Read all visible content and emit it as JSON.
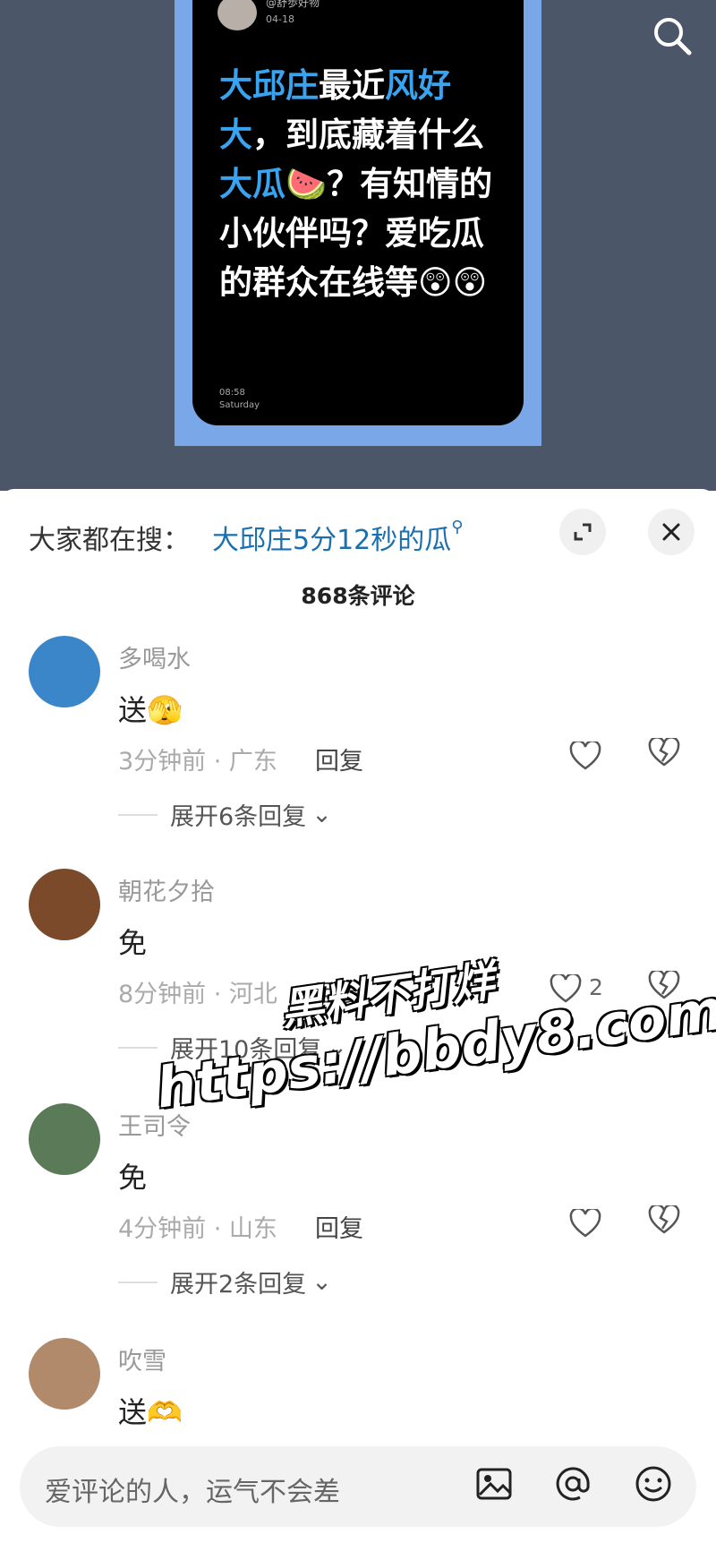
{
  "post": {
    "username": "@舒歩好物",
    "date": "04-18",
    "text_parts": [
      {
        "t": "大邱庄",
        "hl": true
      },
      {
        "t": "最近",
        "hl": false
      },
      {
        "t": "风好大",
        "hl": true
      },
      {
        "t": "，到底藏着什么",
        "hl": false
      },
      {
        "t": "大瓜",
        "hl": true
      },
      {
        "t": "🍉？有知情的小伙伴吗？爱吃瓜的群众在线等😲😲",
        "hl": false
      }
    ],
    "time": "08:58",
    "weekday": "Saturday"
  },
  "sheet": {
    "trend_label": "大家都在搜：",
    "trend_link": "大邱庄5分12秒的瓜",
    "comment_count": "868条评论"
  },
  "comments": [
    {
      "user": "多喝水",
      "text": "送",
      "emoji": "🫣",
      "meta": "3分钟前 · 广东",
      "reply": "回复",
      "likes": "",
      "expand": "展开6条回复",
      "avatar_color": "#3a86c8"
    },
    {
      "user": "朝花夕拾",
      "text": "免",
      "emoji": "",
      "meta": "8分钟前 · 河北",
      "reply": "回复",
      "likes": "2",
      "expand": "展开10条回复",
      "avatar_color": "#7a4a2a"
    },
    {
      "user": "王司令",
      "text": "免",
      "emoji": "",
      "meta": "4分钟前 · 山东",
      "reply": "回复",
      "likes": "",
      "expand": "展开2条回复",
      "avatar_color": "#5a7a58"
    },
    {
      "user": "吹雪",
      "text": "送",
      "emoji": "🫶",
      "meta": "",
      "reply": "",
      "likes": "",
      "expand": "",
      "avatar_color": "#b08a6a"
    }
  ],
  "input": {
    "placeholder": "爱评论的人，运气不会差"
  },
  "watermark": {
    "line1": "黑料不打烊",
    "line2": "https://bbdy8.com"
  },
  "icons": [
    "search-icon",
    "expand-icon",
    "close-icon",
    "heart-icon",
    "broken-heart-icon",
    "image-icon",
    "at-icon",
    "emoji-icon",
    "chevron-down-icon"
  ]
}
